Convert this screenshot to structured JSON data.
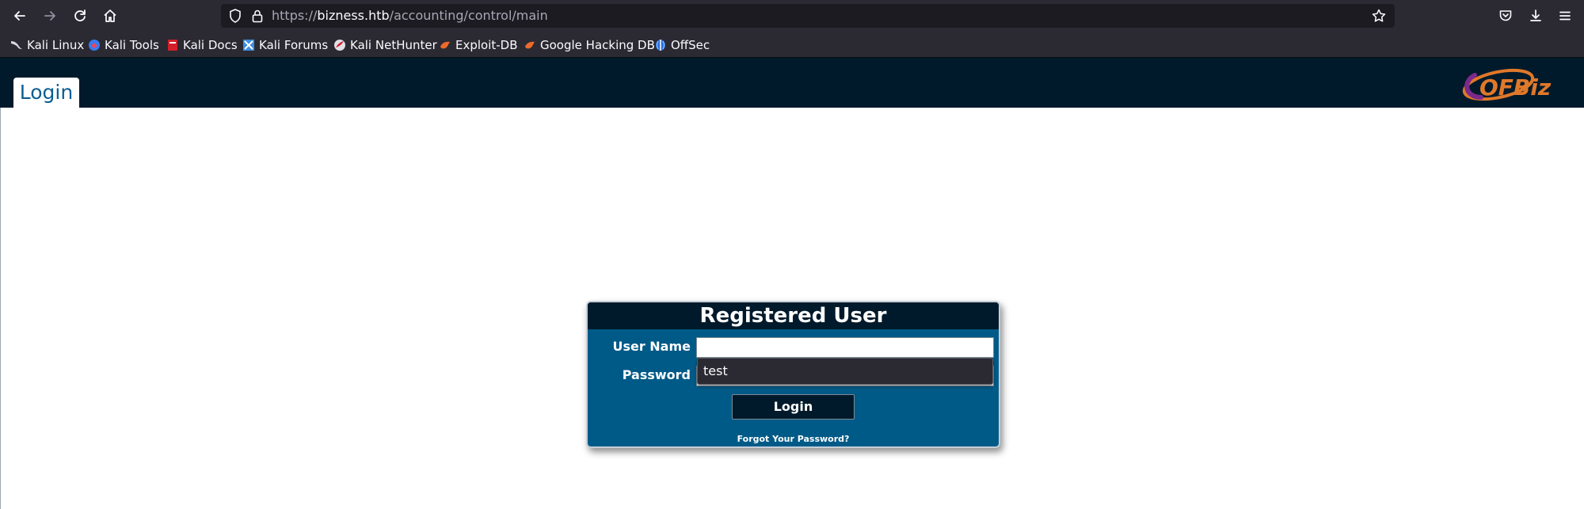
{
  "browser": {
    "url_scheme": "https://",
    "url_domain": "bizness.htb",
    "url_path": "/accounting/control/main",
    "colors": {
      "chrome": "#2b2a33",
      "urlbar": "#1c1b22",
      "text": "#fbfbfe"
    }
  },
  "bookmarks": [
    {
      "label": "Kali Linux",
      "icon": "kali-dragon-icon"
    },
    {
      "label": "Kali Tools",
      "icon": "kali-tools-icon"
    },
    {
      "label": "Kali Docs",
      "icon": "kali-docs-icon"
    },
    {
      "label": "Kali Forums",
      "icon": "kali-forums-icon"
    },
    {
      "label": "Kali NetHunter",
      "icon": "kali-nethunter-icon"
    },
    {
      "label": "Exploit-DB",
      "icon": "exploit-db-icon"
    },
    {
      "label": "Google Hacking DB",
      "icon": "ghdb-icon"
    },
    {
      "label": "OffSec",
      "icon": "offsec-icon"
    }
  ],
  "app": {
    "tab_label": "Login",
    "logo_text": "OFBiz",
    "colors": {
      "header": "#011a2b",
      "panel": "#005a87",
      "tab_text": "#0a5e93"
    }
  },
  "login": {
    "title": "Registered User",
    "username_label": "User Name",
    "password_label": "Password",
    "username_value": "",
    "autocomplete_suggestion": "test",
    "button_label": "Login",
    "forgot_link": "Forgot Your Password?"
  }
}
